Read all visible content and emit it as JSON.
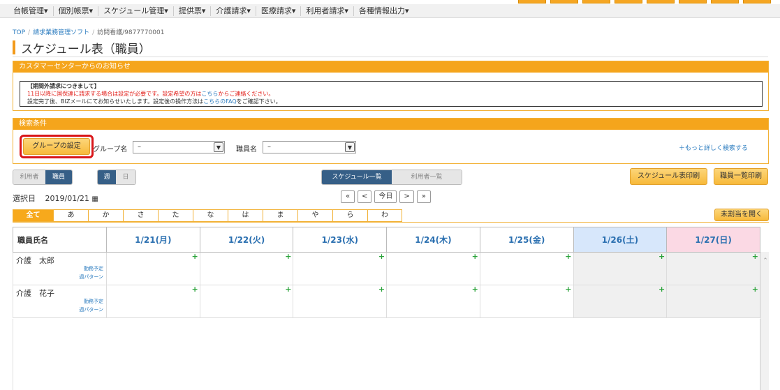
{
  "menu": [
    "台帳管理▾",
    "個別帳票▾",
    "スケジュール管理▾",
    "提供票▾",
    "介護請求▾",
    "医療請求▾",
    "利用者請求▾",
    "各種情報出力▾"
  ],
  "breadcrumb": {
    "top": "TOP",
    "app": "請求業務管理ソフト",
    "office": "訪問看護/9877770001"
  },
  "page_title": "スケジュール表（職員）",
  "notice_panel": {
    "header": "カスタマーセンターからのお知らせ",
    "heading": "【期間外請求につきまして】",
    "line1_red": "11日以降に国保連に請求する場合は設定が必要です。設定希望の方は",
    "line1_link": "こちら",
    "line1_red2": "からご連絡ください。",
    "line2_a": "設定完了後、BIZメールにてお知らせいたします。設定後の操作方法は",
    "line2_link": "こちらのFAQ",
    "line2_b": "をご確認下さい。"
  },
  "search": {
    "header": "検索条件",
    "group_button": "グループの設定",
    "group_label": "グループ名",
    "group_value": "–",
    "staff_label": "職員名",
    "staff_value": "–",
    "more_link": "＋もっと詳しく検索する"
  },
  "toggles": {
    "user": "利用者",
    "staff": "職員",
    "week": "週",
    "day": "日",
    "schedule_list": "スケジュール一覧",
    "user_list": "利用者一覧"
  },
  "buttons": {
    "print_schedule": "スケジュール表印刷",
    "print_staff": "職員一覧印刷",
    "unassigned": "未割当を開く"
  },
  "date": {
    "label": "選択日",
    "value": "2019/01/21",
    "icon": "calendar-icon"
  },
  "nav": {
    "first": "«",
    "prev": "<",
    "today": "今日",
    "next": ">",
    "last": "»"
  },
  "kana_tabs": [
    "全て",
    "あ",
    "か",
    "さ",
    "た",
    "な",
    "は",
    "ま",
    "や",
    "ら",
    "わ"
  ],
  "grid": {
    "name_header": "職員氏名",
    "days": [
      "1/21(月)",
      "1/22(火)",
      "1/23(水)",
      "1/24(木)",
      "1/25(金)",
      "1/26(土)",
      "1/27(日)"
    ],
    "plus": "+",
    "rows": [
      {
        "name": "介護　太郎",
        "sub1": "勤務予定",
        "sub2": "週パターン"
      },
      {
        "name": "介護　花子",
        "sub1": "勤務予定",
        "sub2": "週パターン"
      }
    ]
  },
  "colors": {
    "accent": "#f5a51c",
    "nav_dark": "#365f87",
    "highlight": "#d9161a",
    "link": "#2a7bbf"
  }
}
